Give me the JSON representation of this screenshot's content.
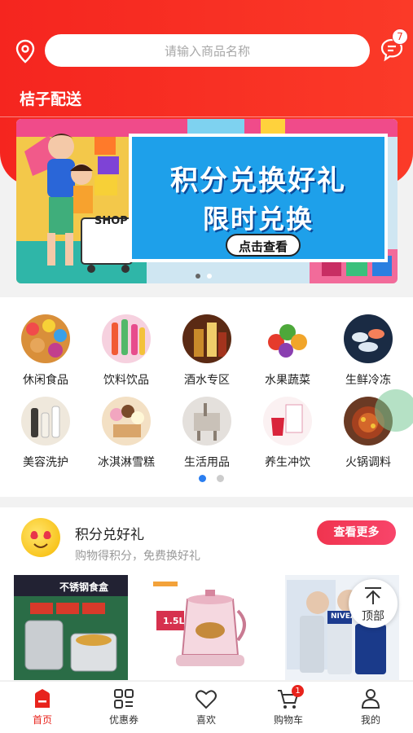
{
  "header": {
    "search_placeholder": "请输入商品名称",
    "message_count": "7",
    "shop_name": "桔子配送",
    "accent_color": "#f5251f"
  },
  "banner": {
    "title_line1": "积分兑换好礼",
    "title_line2": "限时兑换",
    "button_label": "点击查看",
    "shop_sign": "SHOP",
    "page_count": 2,
    "active_page": 1
  },
  "categories": [
    {
      "label": "休闲食品",
      "icon": "snacks-image"
    },
    {
      "label": "饮料饮品",
      "icon": "drinks-image"
    },
    {
      "label": "酒水专区",
      "icon": "liquor-image"
    },
    {
      "label": "水果蔬菜",
      "icon": "fruit-veg-image"
    },
    {
      "label": "生鲜冷冻",
      "icon": "frozen-image"
    },
    {
      "label": "美容洗护",
      "icon": "beauty-image"
    },
    {
      "label": "冰淇淋雪糕",
      "icon": "icecream-image"
    },
    {
      "label": "生活用品",
      "icon": "daily-goods-image"
    },
    {
      "label": "养生冲饮",
      "icon": "health-drink-image"
    },
    {
      "label": "火锅调料",
      "icon": "hotpot-image"
    }
  ],
  "category_pages": {
    "count": 2,
    "active": 1
  },
  "promo": {
    "title": "积分兑好礼",
    "subtitle": "购物得积分，免费换好礼",
    "more_label": "查看更多",
    "products": [
      {
        "name": "stainless-lunchbox",
        "overlay_text": "不锈钢食盒"
      },
      {
        "name": "health-kettle",
        "overlay_text": "1.5L"
      },
      {
        "name": "nivea-men-set",
        "overlay_text": "NIVEA"
      }
    ]
  },
  "back_to_top_label": "顶部",
  "tabbar": {
    "items": [
      {
        "label": "首页",
        "icon": "home-icon",
        "active": true
      },
      {
        "label": "优惠券",
        "icon": "coupon-icon",
        "active": false
      },
      {
        "label": "喜欢",
        "icon": "heart-icon",
        "active": false
      },
      {
        "label": "购物车",
        "icon": "cart-icon",
        "active": false,
        "badge": "1"
      },
      {
        "label": "我的",
        "icon": "user-icon",
        "active": false
      }
    ]
  }
}
